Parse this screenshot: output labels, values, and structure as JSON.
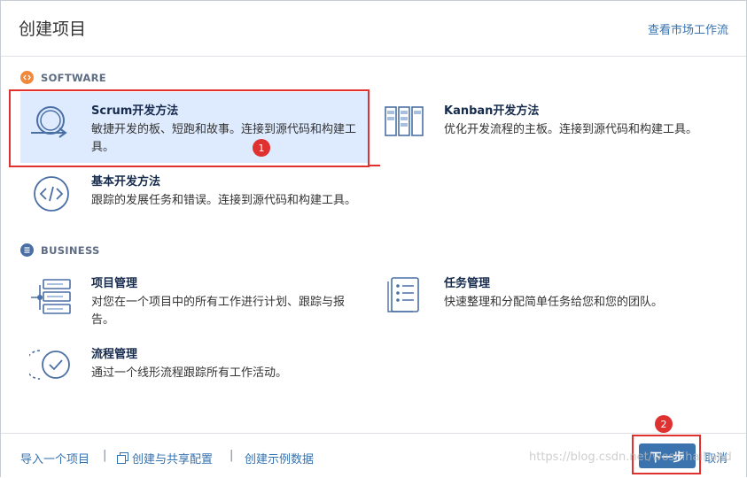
{
  "dialog": {
    "title": "创建项目",
    "market_link": "查看市场工作流"
  },
  "software": {
    "label": "SOFTWARE",
    "cards": {
      "scrum": {
        "name": "Scrum开发方法",
        "desc": "敏捷开发的板、短跑和故事。连接到源代码和构建工具。",
        "icon": "scrum-cycle-icon"
      },
      "kanban": {
        "name": "Kanban开发方法",
        "desc": "优化开发流程的主板。连接到源代码和构建工具。",
        "icon": "kanban-board-icon"
      },
      "basic": {
        "name": "基本开发方法",
        "desc": "跟踪的发展任务和错误。连接到源代码和构建工具。",
        "icon": "code-brackets-icon"
      }
    }
  },
  "business": {
    "label": "BUSINESS",
    "cards": {
      "project": {
        "name": "项目管理",
        "desc": "对您在一个项目中的所有工作进行计划、跟踪与报告。",
        "icon": "project-list-icon"
      },
      "task": {
        "name": "任务管理",
        "desc": "快速整理和分配简单任务给您和您的团队。",
        "icon": "task-checklist-icon"
      },
      "process": {
        "name": "流程管理",
        "desc": "通过一个线形流程跟踪所有工作活动。",
        "icon": "process-check-icon"
      }
    }
  },
  "annotations": {
    "one": "1",
    "two": "2"
  },
  "footer": {
    "import": "导入一个项目",
    "share": "创建与共享配置",
    "sample": "创建示例数据",
    "sep": "|",
    "next": "下一步",
    "cancel": "取消"
  },
  "watermark": "https://blog.csdn.net/woshihaihand",
  "colors": {
    "accent": "#3572b0",
    "selected_bg": "#deebff",
    "annotation": "#e03131",
    "button": "#3b73af"
  }
}
